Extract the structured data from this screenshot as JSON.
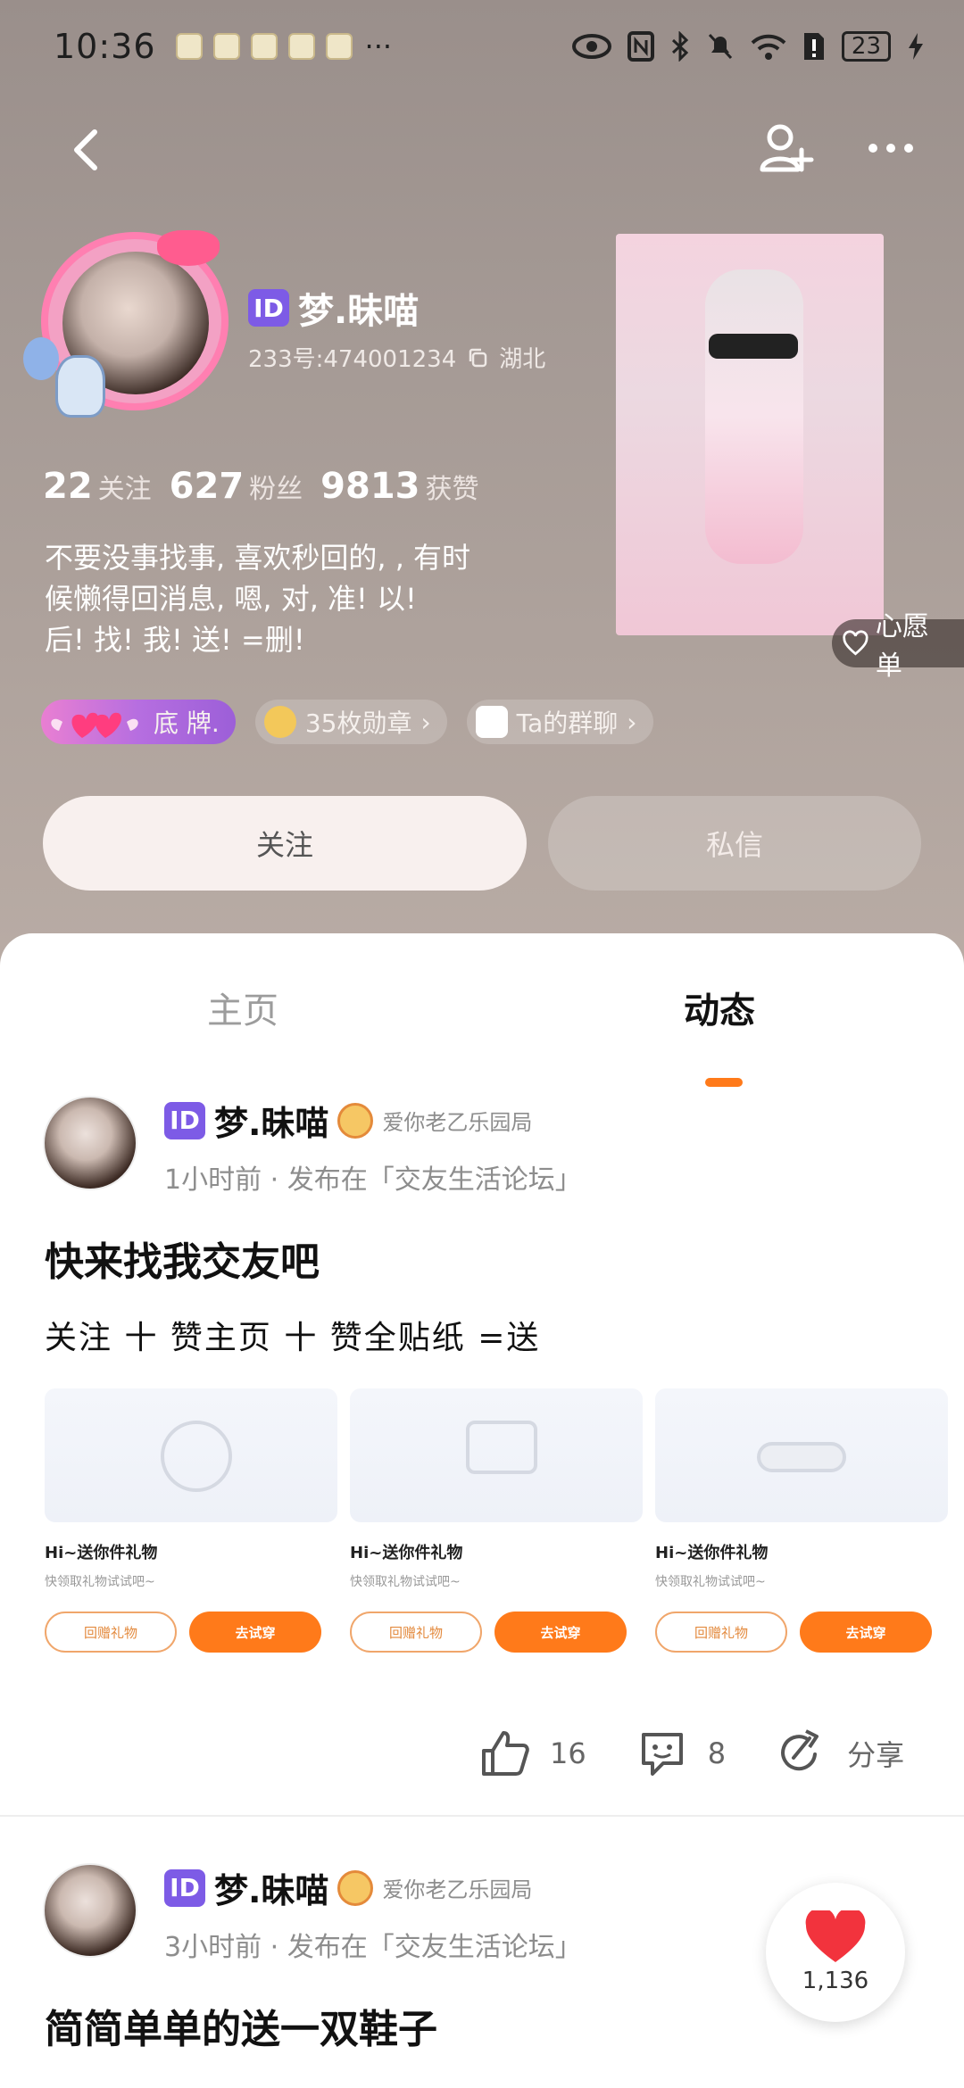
{
  "status_bar": {
    "time": "10:36",
    "more": "···",
    "battery": "23"
  },
  "header": {
    "name": "梦.昧喵",
    "id_badge": "ID",
    "uid": "233号:474001234",
    "location": "湖北",
    "stats": [
      {
        "num": "22",
        "label": "关注"
      },
      {
        "num": "627",
        "label": "粉丝"
      },
      {
        "num": "9813",
        "label": "获赞"
      }
    ],
    "bio_lines": [
      "不要没事找事, 喜欢秒回的, , 有时",
      "候懒得回消息, 嗯, 对, 准! 以!",
      "后! 找! 我! 送! =删!"
    ],
    "wishlist": "心愿单",
    "chips": {
      "brand": "底 牌.",
      "medals": "35枚勋章",
      "group": "Ta的群聊"
    },
    "follow_btn": "关注",
    "dm_btn": "私信"
  },
  "tabs": {
    "home": "主页",
    "feed": "动态"
  },
  "posts": [
    {
      "author": "梦.昧喵",
      "medal_text": "爱你老乙乐园局",
      "time": "1小时前 · 发布在「交友生活论坛」",
      "title": "快来找我交友吧",
      "body": "关注  十  赞主页   十   赞全贴纸  =送"
    },
    {
      "author": "梦.昧喵",
      "medal_text": "爱你老乙乐园局",
      "time": "3小时前 · 发布在「交友生活论坛」",
      "title": "简简单单的送一双鞋子"
    }
  ],
  "gifts": [
    {
      "title": "Hi~送你件礼物",
      "sub": "快领取礼物试试吧~",
      "btn1": "回赠礼物",
      "btn2": "去试穿"
    },
    {
      "title": "Hi~送你件礼物",
      "sub": "快领取礼物试试吧~",
      "btn1": "回赠礼物",
      "btn2": "去试穿"
    },
    {
      "title": "Hi~送你件礼物",
      "sub": "快领取礼物试试吧~",
      "btn1": "回赠礼物",
      "btn2": "去试穿"
    }
  ],
  "actions": {
    "likes": "16",
    "comments": "8",
    "share": "分享"
  },
  "fab": {
    "count": "1,136"
  },
  "colors": {
    "accent": "#ff7a1a",
    "id_badge": "#7d5be6"
  }
}
